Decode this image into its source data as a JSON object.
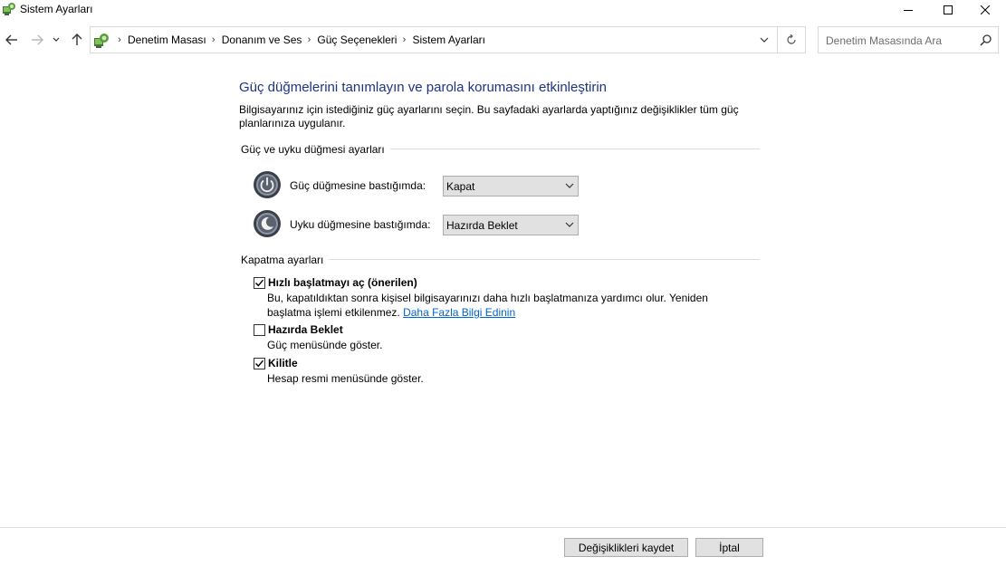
{
  "window": {
    "title": "Sistem Ayarları",
    "icon": "control-panel-icon"
  },
  "nav": {
    "back_icon": "arrow-left-icon",
    "forward_icon": "arrow-right-icon",
    "recent_icon": "chevron-down-icon",
    "up_icon": "arrow-up-icon"
  },
  "address": {
    "breadcrumbs": [
      "Denetim Masası",
      "Donanım ve Ses",
      "Güç Seçenekleri",
      "Sistem Ayarları"
    ],
    "separator": "›"
  },
  "search": {
    "placeholder": "Denetim Masasında Ara"
  },
  "page": {
    "heading": "Güç düğmelerini tanımlayın ve parola korumasını etkinleştirin",
    "intro": "Bilgisayarınız için istediğiniz güç ayarlarını seçin. Bu sayfadaki ayarlarda yaptığınız değişiklikler tüm güç planlarınıza uygulanır."
  },
  "power_section": {
    "title": "Güç ve uyku düğmesi ayarları",
    "power_button": {
      "label": "Güç düğmesine bastığımda:",
      "value": "Kapat"
    },
    "sleep_button": {
      "label": "Uyku düğmesine bastığımda:",
      "value": "Hazırda Beklet"
    }
  },
  "shutdown_section": {
    "title": "Kapatma ayarları",
    "fast_startup": {
      "label": "Hızlı başlatmayı aç (önerilen)",
      "checked": true,
      "desc": "Bu, kapatıldıktan sonra kişisel bilgisayarınızı daha hızlı başlatmanıza yardımcı olur. Yeniden başlatma işlemi etkilenmez.",
      "link": "Daha Fazla Bilgi Edinin"
    },
    "hibernate": {
      "label": "Hazırda Beklet",
      "checked": false,
      "desc": "Güç menüsünde göster."
    },
    "lock": {
      "label": "Kilitle",
      "checked": true,
      "desc": "Hesap resmi menüsünde göster."
    }
  },
  "footer": {
    "save_label": "Değişiklikleri kaydet",
    "cancel_label": "İptal"
  }
}
